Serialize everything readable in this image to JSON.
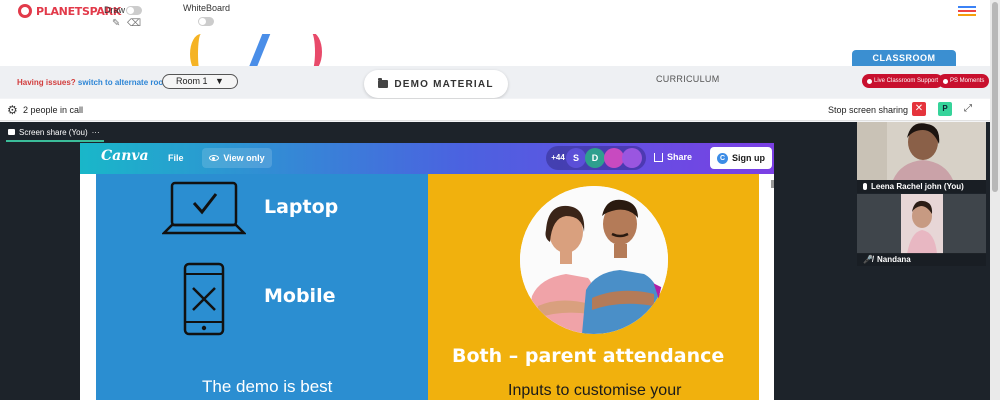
{
  "brand": {
    "logo_text": "PLANETSPARK",
    "accent": "#e23a4a"
  },
  "tools": {
    "draw_label": "Draw",
    "whiteboard_label": "WhiteBoard",
    "draw_icons": [
      "pencil-icon",
      "eraser-icon"
    ]
  },
  "menu": {
    "icon": "hamburger-icon",
    "colors": [
      "#3b82f6",
      "#ef4444",
      "#f59e0b"
    ]
  },
  "classroom_tab": {
    "label": "CLASSROOM"
  },
  "control_bar": {
    "issue_text": "Having issues?",
    "issue_link": "switch to alternate room",
    "room_select": "Room 1",
    "demo_button": "DEMO MATERIAL",
    "curriculum": "CURRICULUM",
    "live_support": "Live Classroom Support",
    "ps_moments": "PS Moments"
  },
  "call_bar": {
    "people_count": "2 people in call",
    "stop_sharing": "Stop screen sharing",
    "close_label": "✕",
    "p_label": "P",
    "expand_icon": "expand-icon"
  },
  "share": {
    "tab_label": "Screen share (You)",
    "more_label": "···"
  },
  "canva": {
    "logo": "Canva",
    "file": "File",
    "view_only": "View only",
    "extra_count": "+44",
    "avatars": [
      "S",
      "D"
    ],
    "share": "Share",
    "signup": "Sign up",
    "bar_colors": [
      "#19b7c9",
      "#4b62e0",
      "#7b3fe4"
    ]
  },
  "slide": {
    "laptop_label": "Laptop",
    "mobile_label": "Mobile",
    "demo_text": "The demo is best",
    "both_text": "Both – parent attendance",
    "inputs_text": "Inputs to customise your",
    "left_color": "#2b8ed1",
    "right_color": "#f1b10d"
  },
  "participants": [
    {
      "name": "Leena Rachel john (You)",
      "mic": "mic-icon"
    },
    {
      "name": "Nandana",
      "mic": "mic-muted-icon"
    }
  ]
}
